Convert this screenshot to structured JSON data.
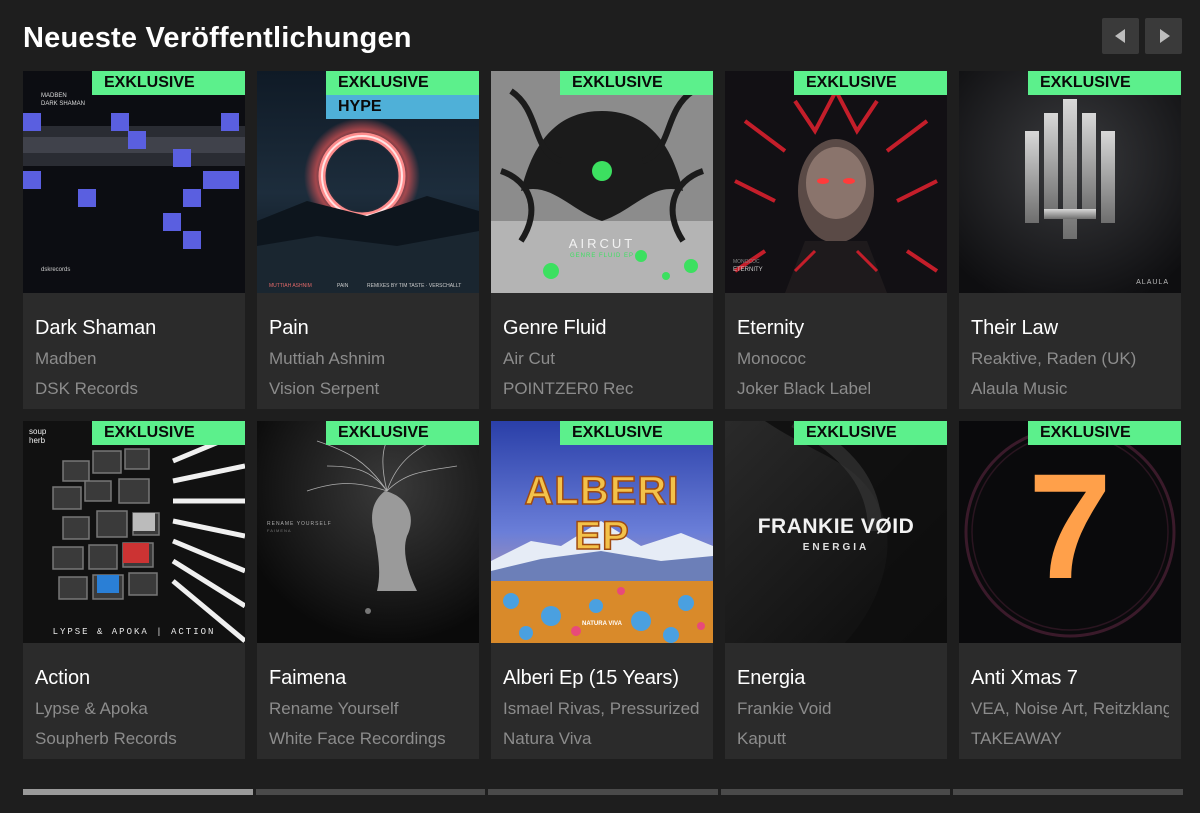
{
  "section": {
    "title": "Neueste Veröffentlichungen"
  },
  "nav": {
    "prev_icon": "chevron-left-icon",
    "next_icon": "chevron-right-icon"
  },
  "colors": {
    "exclusive": "#5cf08c",
    "hype": "#4fb0d8",
    "card_bg": "#2b2b2b",
    "page_bg": "#1e1e1e"
  },
  "cover_text": {
    "dark_shaman_artist": "MADBEN",
    "dark_shaman_title": "DARK SHAMAN",
    "dark_shaman_label": "dskrecords",
    "pain_artist": "MUTTIAH ASHNIM",
    "pain_title": "PAIN",
    "pain_credits": "REMIXES BY TIM TASTE · VERSCHALLT",
    "genre_fluid_artist": "AIRCUT",
    "genre_fluid_title": "GENRE FLUID EP",
    "eternity_artist": "MONOCOC",
    "eternity_title": "ETERNITY",
    "their_law_label": "ALAULA",
    "action_label": "soup herb",
    "action_bottom": "LYPSE & APOKA | ACTION",
    "faimena_artist": "RENAME YOURSELF",
    "faimena_title": "FAIMENA",
    "alberi_title": "ALBERI EP",
    "alberi_label": "NATURA VIVA",
    "energia_artist": "FRANKIE VØID",
    "energia_title": "ENERGIA",
    "xmas_number": "7"
  },
  "releases": [
    {
      "title": "Dark Shaman",
      "artists": "Madben",
      "label": "DSK Records",
      "badges": [
        "EXKLUSIVE"
      ]
    },
    {
      "title": "Pain",
      "artists": "Muttiah Ashnim",
      "label": "Vision Serpent",
      "badges": [
        "EXKLUSIVE",
        "HYPE"
      ]
    },
    {
      "title": "Genre Fluid",
      "artists": "Air Cut",
      "label": "POINTZER0 Rec",
      "badges": [
        "EXKLUSIVE"
      ]
    },
    {
      "title": "Eternity",
      "artists": "Monococ",
      "label": "Joker Black Label",
      "badges": [
        "EXKLUSIVE"
      ]
    },
    {
      "title": "Their Law",
      "artists": "Reaktive, Raden (UK)",
      "label": "Alaula Music",
      "badges": [
        "EXKLUSIVE"
      ]
    },
    {
      "title": "Action",
      "artists": "Lypse & Apoka",
      "label": "Soupherb Records",
      "badges": [
        "EXKLUSIVE"
      ]
    },
    {
      "title": "Faimena",
      "artists": "Rename Yourself",
      "label": "White Face Recordings",
      "badges": [
        "EXKLUSIVE"
      ]
    },
    {
      "title": "Alberi Ep (15 Years)",
      "artists": "Ismael Rivas, Pressurized",
      "label": "Natura Viva",
      "badges": [
        "EXKLUSIVE"
      ]
    },
    {
      "title": "Energia",
      "artists": "Frankie Void",
      "label": "Kaputt",
      "badges": [
        "EXKLUSIVE"
      ]
    },
    {
      "title": "Anti Xmas 7",
      "artists": "VEA, Noise Art, Reitzklang",
      "label": "TAKEAWAY",
      "badges": [
        "EXKLUSIVE"
      ]
    }
  ],
  "pager": {
    "pages": 5,
    "active_page": 1
  }
}
